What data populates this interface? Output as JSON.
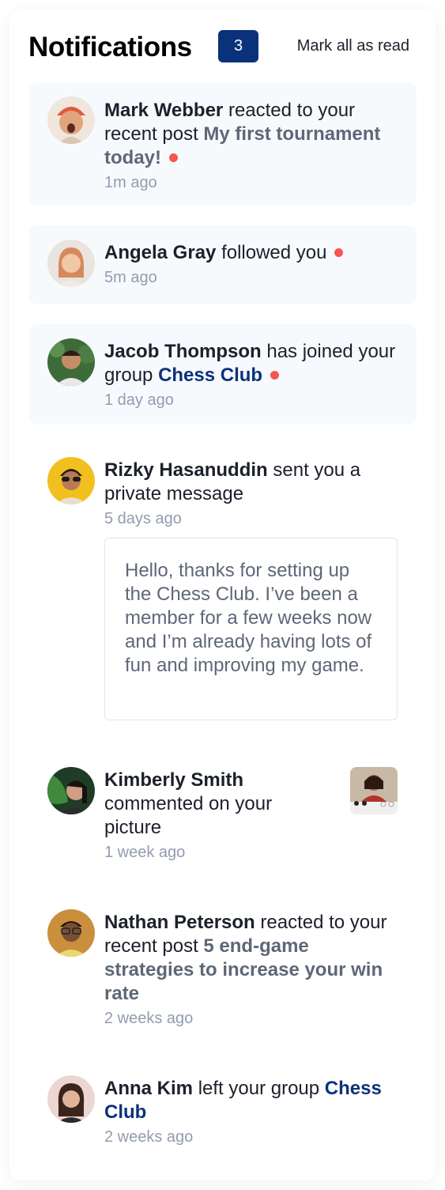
{
  "header": {
    "title": "Notifications",
    "unread_count": "3",
    "mark_all_label": "Mark all as read"
  },
  "colors": {
    "accent_blue": "#0a327b",
    "unread_background": "#f7fafd",
    "unread_dot": "#f65552",
    "muted_text": "#939caf",
    "post_text": "#5e6778"
  },
  "notifications": [
    {
      "name": "Mark Webber",
      "action": "reacted to your recent post",
      "target": "My first tournament today!",
      "time": "1m ago",
      "unread": true
    },
    {
      "name": "Angela Gray",
      "action": "followed you",
      "time": "5m ago",
      "unread": true
    },
    {
      "name": "Jacob Thompson",
      "action": "has joined your group",
      "target": "Chess Club",
      "time": "1 day ago",
      "unread": true
    },
    {
      "name": "Rizky Hasanuddin",
      "action": "sent you a private message",
      "time": "5 days ago",
      "message": "Hello, thanks for setting up the Chess Club. I’ve been a member for a few weeks now and I’m already having lots of fun and improving my game.",
      "unread": false
    },
    {
      "name": "Kimberly Smith",
      "action": "commented on your picture",
      "time": "1 week ago",
      "unread": false
    },
    {
      "name": "Nathan Peterson",
      "action": "reacted to your recent post",
      "target": "5 end-game strategies to increase your win rate",
      "time": "2 weeks ago",
      "unread": false
    },
    {
      "name": "Anna Kim",
      "action": "left your group",
      "target": "Chess Club",
      "time": "2 weeks ago",
      "unread": false
    }
  ]
}
